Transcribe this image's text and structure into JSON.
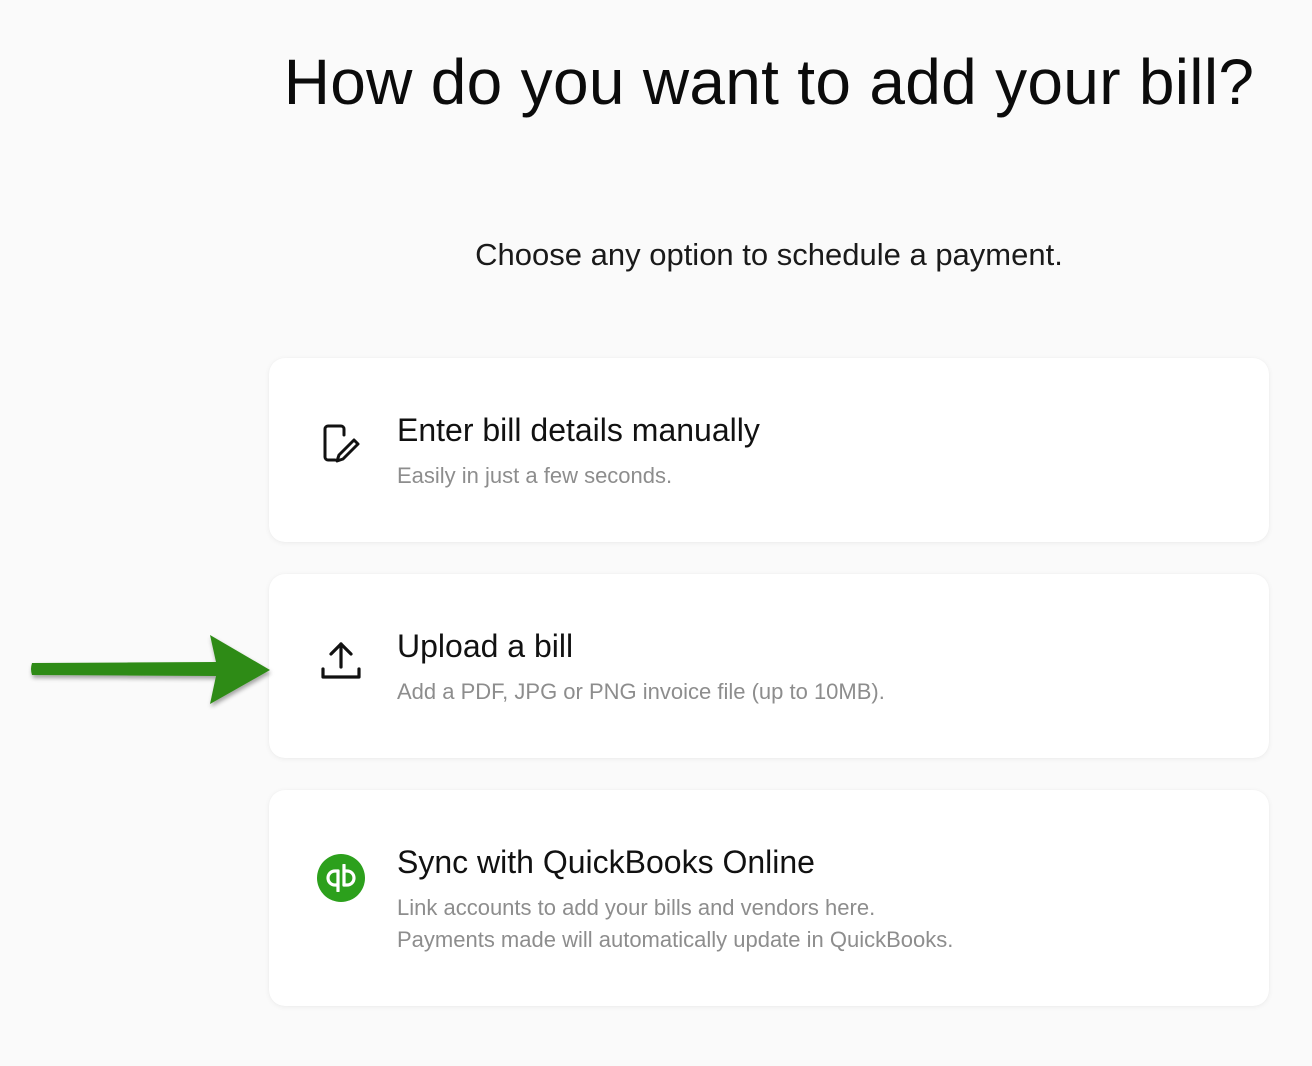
{
  "heading": {
    "title": "How do you want to add your bill?",
    "subtitle": "Choose any option to schedule a payment."
  },
  "options": [
    {
      "icon": "edit-document-icon",
      "title": "Enter bill details manually",
      "description": "Easily in just a few seconds."
    },
    {
      "icon": "upload-icon",
      "title": "Upload a bill",
      "description": "Add a PDF, JPG or PNG invoice file (up to 10MB)."
    },
    {
      "icon": "quickbooks-logo-icon",
      "title": "Sync with QuickBooks Online",
      "description_line1": "Link accounts to add your bills and vendors here.",
      "description_line2": "Payments made will automatically update in QuickBooks."
    }
  ],
  "annotation": {
    "icon": "pointer-arrow-icon",
    "color": "#2e8b16"
  },
  "colors": {
    "background": "#fafafa",
    "card": "#ffffff",
    "title_text": "#111111",
    "muted_text": "#8d8d8d",
    "quickbooks_green": "#2ca01c"
  }
}
